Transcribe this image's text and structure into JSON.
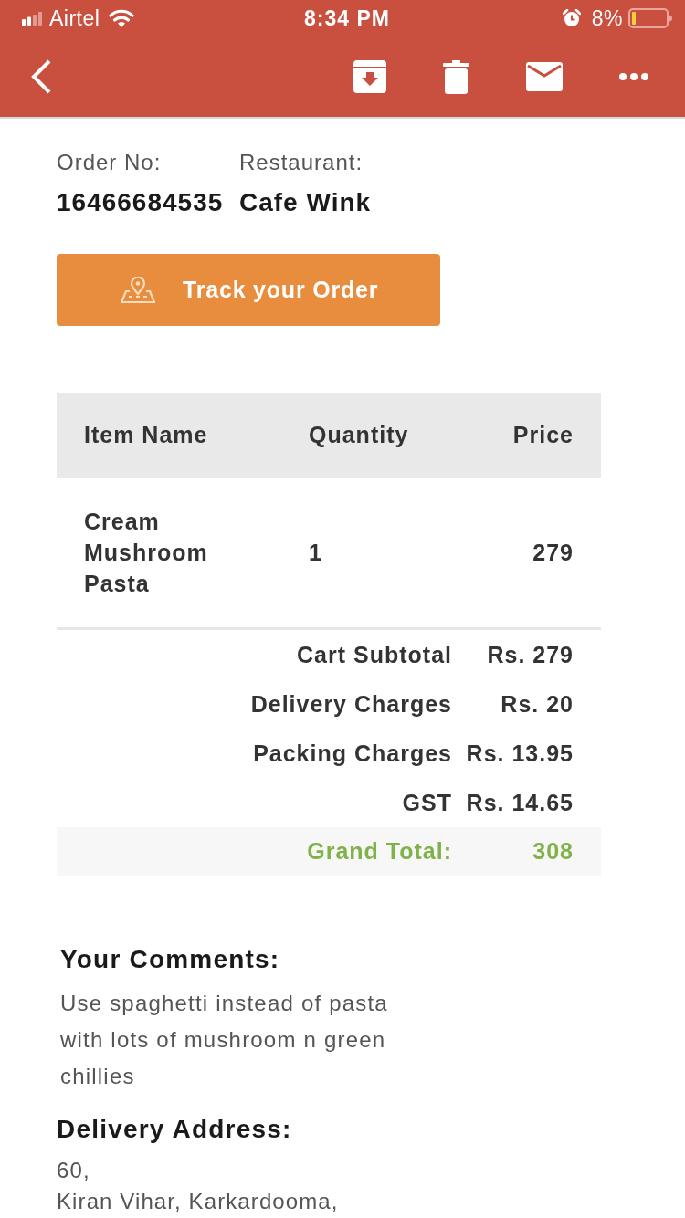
{
  "status_bar": {
    "carrier": "Airtel",
    "time": "8:34 PM",
    "battery": "8%"
  },
  "order": {
    "order_no_label": "Order No:",
    "order_no": "16466684535",
    "restaurant_label": "Restaurant:",
    "restaurant": "Cafe Wink"
  },
  "track_button": {
    "label": "Track your Order"
  },
  "items_table": {
    "columns": [
      "Item Name",
      "Quantity",
      "Price"
    ],
    "rows": [
      {
        "item": "Cream Mushroom Pasta",
        "quantity": "1",
        "price": "279"
      }
    ]
  },
  "totals": [
    {
      "kind": "charge",
      "label": "Cart Subtotal",
      "value": "Rs. 279"
    },
    {
      "kind": "charge",
      "label": "Delivery Charges",
      "value": "Rs. 20"
    },
    {
      "kind": "charge",
      "label": "Packing Charges",
      "value": "Rs. 13.95"
    },
    {
      "kind": "charge",
      "label": "GST",
      "value": "Rs. 14.65"
    },
    {
      "kind": "grand",
      "label": "Grand Total:",
      "value": "308"
    }
  ],
  "comments": {
    "heading": "Your Comments:",
    "text": "Use spaghetti instead of pasta with lots of mushroom n green chillies"
  },
  "delivery_address": {
    "heading": "Delivery Address:",
    "lines": [
      "60,",
      "Kiran Vihar, Karkardooma,"
    ]
  }
}
